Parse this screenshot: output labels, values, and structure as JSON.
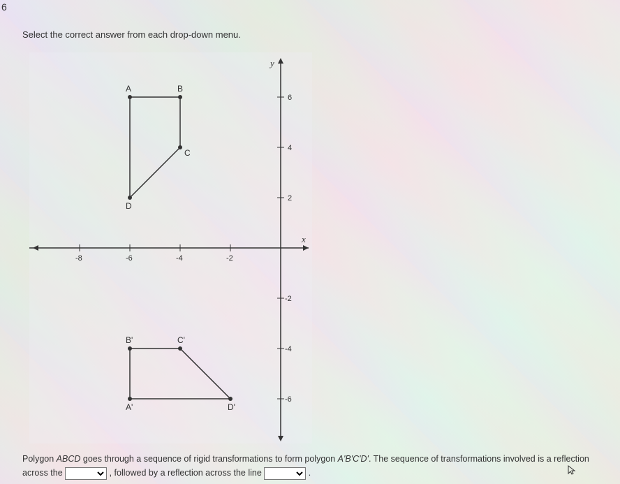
{
  "question_number": "6",
  "instruction": "Select the correct answer from each drop-down menu.",
  "chart_data": {
    "type": "coordinate_plane",
    "x_axis": {
      "label": "x",
      "range": [
        -9,
        1
      ],
      "ticks": [
        -8,
        -6,
        -4,
        -2
      ]
    },
    "y_axis": {
      "label": "y",
      "range": [
        -7,
        7
      ],
      "ticks": [
        6,
        4,
        2,
        -2,
        -4,
        -6
      ]
    },
    "polygons": [
      {
        "name": "ABCD",
        "vertices": [
          {
            "label": "A",
            "x": -6,
            "y": 6
          },
          {
            "label": "B",
            "x": -4,
            "y": 6
          },
          {
            "label": "C",
            "x": -4,
            "y": 4
          },
          {
            "label": "D",
            "x": -6,
            "y": 2
          }
        ]
      },
      {
        "name": "A'B'C'D'",
        "vertices": [
          {
            "label": "B'",
            "x": -6,
            "y": -4
          },
          {
            "label": "C'",
            "x": -4,
            "y": -4
          },
          {
            "label": "D'",
            "x": -2,
            "y": -6
          },
          {
            "label": "A'",
            "x": -6,
            "y": -6
          }
        ]
      }
    ]
  },
  "question": {
    "part1": "Polygon ",
    "polygon1": "ABCD",
    "part2": " goes through a sequence of rigid transformations to form polygon ",
    "polygon2": "A'B'C'D'",
    "part3": ". The sequence of transformations involved is a reflection across the ",
    "part4": " , followed by a reflection across the line ",
    "part5": " ."
  }
}
